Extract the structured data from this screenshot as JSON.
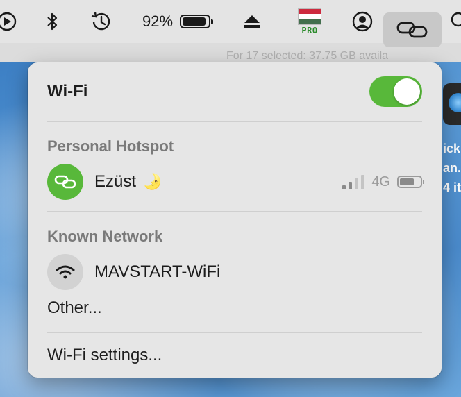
{
  "menubar": {
    "battery_percent": "92%",
    "battery_level": 0.92,
    "flag_colors": [
      "#cd2a3e",
      "#ffffff",
      "#436f4d"
    ],
    "flag_badge": "PRO",
    "icons": [
      "play-circle-icon",
      "bluetooth-icon",
      "time-machine-icon",
      "battery-icon",
      "eject-icon",
      "keyboard-input-hungarian-flag-icon",
      "user-account-icon",
      "personal-hotspot-icon",
      "search-icon"
    ]
  },
  "background": {
    "finder_ghost_text": "For 17 selected: 37.75 GB availa",
    "edge_texts": [
      "ick",
      "an...",
      "4 it"
    ]
  },
  "wifi_menu": {
    "title": "Wi-Fi",
    "toggle_on": true,
    "accent_color": "#58b83a",
    "personal_hotspot": {
      "heading": "Personal Hotspot",
      "device_name": "Ezüst",
      "device_emoji": "🌛",
      "signal_bars_filled": 2,
      "signal_bars_total": 4,
      "network_type": "4G",
      "battery_level": 0.75
    },
    "known_network": {
      "heading": "Known Network",
      "name": "MAVSTART-WiFi"
    },
    "other_label": "Other...",
    "settings_label": "Wi-Fi settings..."
  }
}
